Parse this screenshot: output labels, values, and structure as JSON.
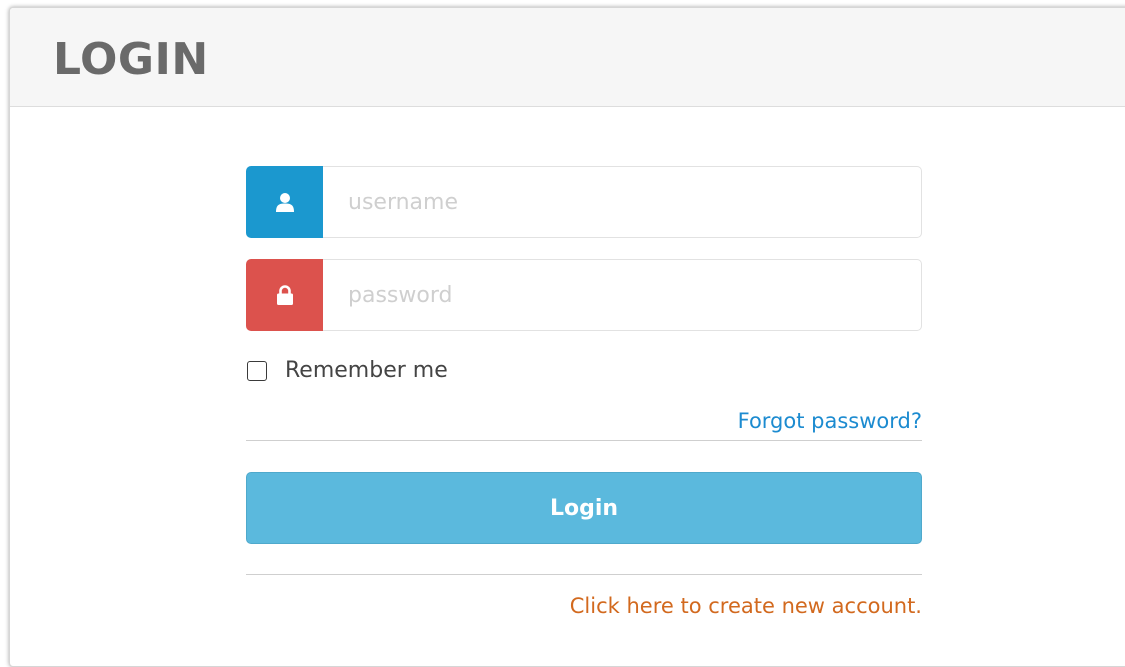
{
  "header": {
    "title": "LOGIN"
  },
  "form": {
    "username": {
      "value": "",
      "placeholder": "username",
      "icon": "user-icon",
      "addon_color": "#1b98cf"
    },
    "password": {
      "value": "",
      "placeholder": "password",
      "icon": "lock-icon",
      "addon_color": "#dc524d"
    },
    "remember": {
      "label": "Remember me",
      "checked": false
    },
    "forgot_label": "Forgot password?",
    "login_label": "Login",
    "create_label": "Click here to create new account."
  },
  "colors": {
    "link": "#1c8bd0",
    "button": "#5bb9dd",
    "create_link": "#d2691e"
  }
}
